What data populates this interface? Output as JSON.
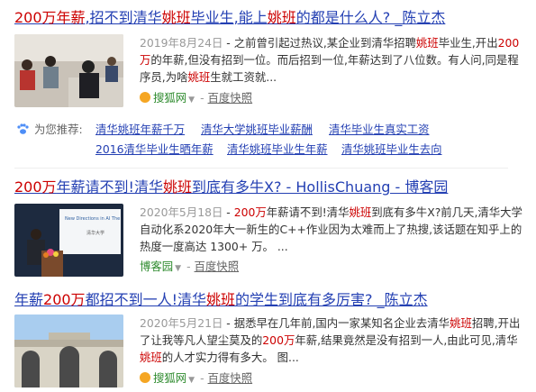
{
  "results": [
    {
      "title_parts": [
        "200万年薪",
        ",招不到清华",
        "姚班",
        "毕业生,能上",
        "姚班",
        "的都是什么人? _陈立杰"
      ],
      "date": "2019年8月24日",
      "snippet_parts": [
        " - 之前曾引起过热议,某企业到清华招聘",
        "姚班",
        "毕业生,开出",
        "200万",
        "的年薪,但没有招到一位。而后招到一位,年薪达到了八位数。有人问,同是程序员,为啥",
        "姚班",
        "生就工资就..."
      ],
      "source": "搜狐网",
      "cache": "百度快照"
    },
    {
      "title_parts": [
        "200万",
        "年薪请不到!清华",
        "姚班",
        "到底有多牛X? - HollisChuang - 博客园"
      ],
      "date": "2020年5月18日",
      "snippet_parts": [
        " - ",
        "200万",
        "年薪请不到!清华",
        "姚班",
        "到底有多牛X?前几天,清华大学自动化系2020年大一新生的C++作业因为太难而上了热搜,该话题在知乎上的热度一度高达 1300+ 万。 ..."
      ],
      "source": "博客园",
      "cache": "百度快照"
    },
    {
      "title_parts": [
        "年薪",
        "200万",
        "都招不到一人!清华",
        "姚班",
        "的学生到底有多厉害? _陈立杰"
      ],
      "date": "2020年5月21日",
      "snippet_parts": [
        " - 据悉早在几年前,国内一家某知名企业去清华",
        "姚班",
        "招聘,开出了让我等凡人望尘莫及的",
        "200万",
        "年薪,结果竟然是没有招到一人,由此可见,清华",
        "姚班",
        "的人才实力得有多大。 图..."
      ],
      "source": "搜狐网",
      "cache": "百度快照"
    }
  ],
  "recommend": {
    "label": "为您推荐:",
    "links": [
      "清华姚班年薪千万",
      "清华大学姚班毕业薪酬",
      "清华毕业生真实工资",
      "2016清华毕业生晒年薪",
      "清华姚班毕业生年薪",
      "清华姚班毕业生去向"
    ]
  },
  "thumb2_text": [
    "New Directions in AI The",
    "清华大学"
  ],
  "colors": {
    "link": "#2440b3",
    "highlight": "#cc0000",
    "source": "#2e8b2e",
    "muted": "#999999"
  }
}
